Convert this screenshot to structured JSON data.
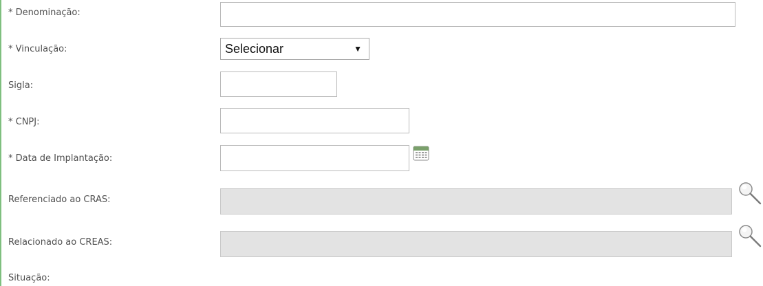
{
  "form": {
    "denominacao": {
      "label": "* Denominação:",
      "value": ""
    },
    "vinculacao": {
      "label": "* Vinculação:",
      "selected": "Selecionar"
    },
    "sigla": {
      "label": "Sigla:",
      "value": ""
    },
    "cnpj": {
      "label": "* CNPJ:",
      "value": ""
    },
    "data_implantacao": {
      "label": "* Data de Implantação:",
      "value": ""
    },
    "referenciado_cras": {
      "label": "Referenciado ao CRAS:",
      "value": ""
    },
    "relacionado_creas": {
      "label": "Relacionado ao CREAS:",
      "value": ""
    },
    "situacao": {
      "label": "Situação:"
    }
  },
  "icons": {
    "calendar": "calendar-icon",
    "search": "search-icon"
  },
  "colors": {
    "left_border": "#7fbf7f",
    "disabled_input": "#e3e3e3",
    "label_text": "#4f4f4f"
  }
}
